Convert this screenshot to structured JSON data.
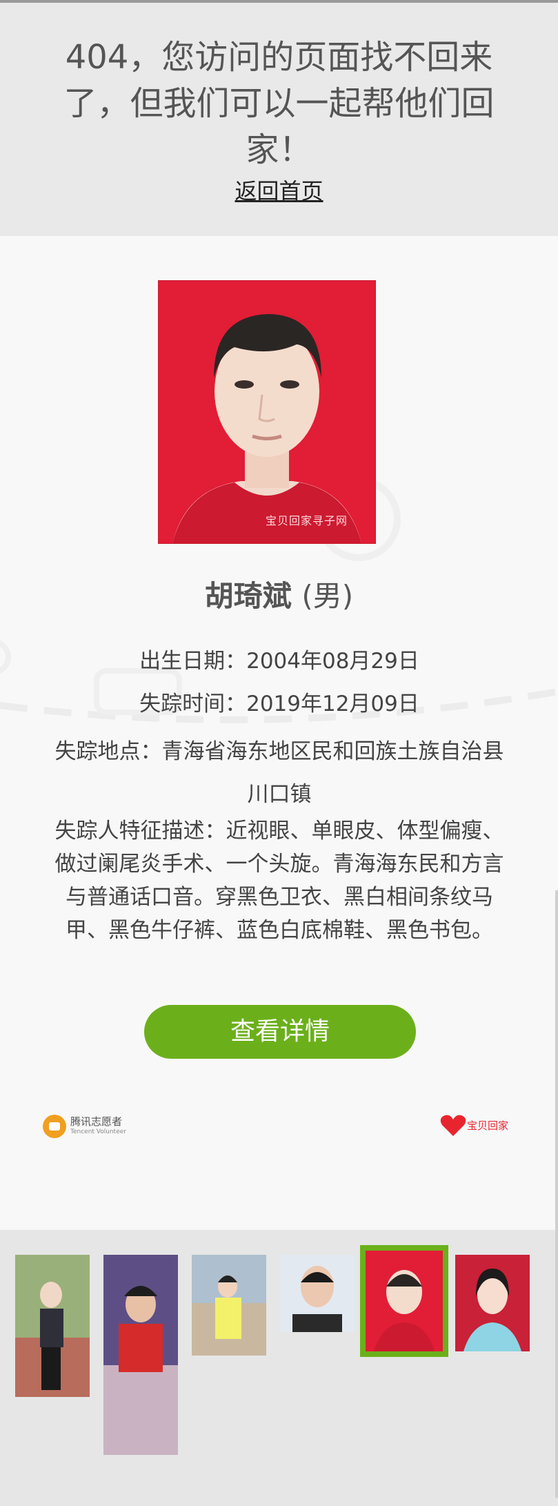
{
  "header": {
    "message": "404，您访问的页面找不回来了，但我们可以一起帮他们回家！",
    "home_link": "返回首页"
  },
  "person": {
    "photo_watermark": "宝贝回家寻子网",
    "name": "胡琦斌",
    "gender": "(男)",
    "birth_date": "出生日期：2004年08月29日",
    "missing_time": "失踪时间：2019年12月09日",
    "missing_place": "失踪地点：青海省海东地区民和回族土族自治县川口镇",
    "description": "失踪人特征描述：近视眼、单眼皮、体型偏瘦、做过阑尾炎手术、一个头旋。青海海东民和方言与普通话口音。穿黑色卫衣、黑白相间条纹马甲、黑色牛仔裤、蓝色白底棉鞋、黑色书包。"
  },
  "details_button": "查看详情",
  "logos": {
    "left_cn": "腾讯志愿者",
    "left_en": "Tencent Volunteer",
    "right_cn": "宝贝回家"
  },
  "colors": {
    "accent": "#6bb01b",
    "photo_bg": "#e21d36",
    "header_bg": "#e9e9e9"
  }
}
